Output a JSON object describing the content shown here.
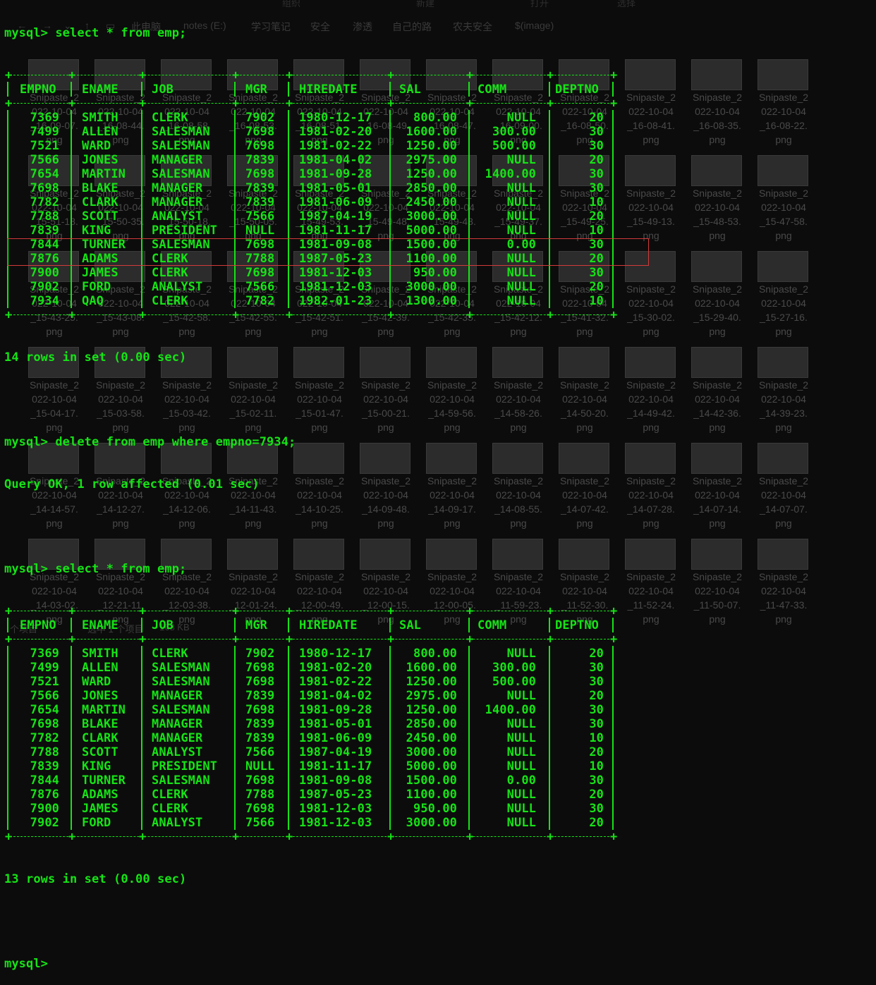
{
  "explorer": {
    "ribbon": [
      "组织",
      "新建",
      "打开",
      "选择"
    ],
    "path": [
      "此电脑",
      "notes (E:)",
      "学习笔记",
      "安全",
      "渗透",
      "自己的路",
      "农夫安全",
      "$(image)"
    ],
    "thumbnails": [
      {
        "col": 0,
        "row": 0,
        "l1": "Snipaste_2",
        "l2": "022-10-04",
        "l3": "_16-09-07.",
        "l4": "png"
      },
      {
        "col": 1,
        "row": 0,
        "l1": "Snipaste_2",
        "l2": "022-10-04",
        "l3": "_16-08-44.",
        "l4": "png"
      },
      {
        "col": 2,
        "row": 0,
        "l1": "Snipaste_2",
        "l2": "022-10-04",
        "l3": "_16-08-58.",
        "l4": "png"
      },
      {
        "col": 3,
        "row": 0,
        "l1": "Snipaste_2",
        "l2": "022-10-04",
        "l3": "_16-08-53.",
        "l4": "png"
      },
      {
        "col": 4,
        "row": 0,
        "l1": "Snipaste_2",
        "l2": "022-10-04",
        "l3": "_16-08-51.",
        "l4": "png"
      },
      {
        "col": 5,
        "row": 0,
        "l1": "Snipaste_2",
        "l2": "022-10-04",
        "l3": "_16-08-49.",
        "l4": "png"
      },
      {
        "col": 6,
        "row": 0,
        "l1": "Snipaste_2",
        "l2": "022-10-04",
        "l3": "_16-08-47.",
        "l4": "png"
      },
      {
        "col": 7,
        "row": 0,
        "l1": "Snipaste_2",
        "l2": "022-10-04",
        "l3": "_16-09-00.",
        "l4": "png"
      },
      {
        "col": 8,
        "row": 0,
        "l1": "Snipaste_2",
        "l2": "022-10-04",
        "l3": "_16-08-50.",
        "l4": "png"
      },
      {
        "col": 9,
        "row": 0,
        "l1": "Snipaste_2",
        "l2": "022-10-04",
        "l3": "_16-08-41.",
        "l4": "png"
      },
      {
        "col": 10,
        "row": 0,
        "l1": "Snipaste_2",
        "l2": "022-10-04",
        "l3": "_16-08-35.",
        "l4": "png"
      },
      {
        "col": 11,
        "row": 0,
        "l1": "Snipaste_2",
        "l2": "022-10-04",
        "l3": "_16-08-22.",
        "l4": "png"
      },
      {
        "col": 0,
        "row": 1,
        "l1": "Snipaste_2",
        "l2": "022-10-04",
        "l3": "_15-51-18.",
        "l4": "png"
      },
      {
        "col": 1,
        "row": 1,
        "l1": "Snipaste_2",
        "l2": "022-10-04",
        "l3": "_15-50-35.",
        "l4": "png"
      },
      {
        "col": 2,
        "row": 1,
        "l1": "Snipaste_2",
        "l2": "022-10-04",
        "l3": "_15-50-18.",
        "l4": "png"
      },
      {
        "col": 3,
        "row": 1,
        "l1": "Snipaste_2",
        "l2": "022-10-04",
        "l3": "_15-50-05.",
        "l4": "png"
      },
      {
        "col": 4,
        "row": 1,
        "l1": "Snipaste_2",
        "l2": "022-10-04",
        "l3": "_15-49-53.",
        "l4": "png"
      },
      {
        "col": 5,
        "row": 1,
        "l1": "Snipaste_2",
        "l2": "022-10-04",
        "l3": "_15-49-48.",
        "l4": "png"
      },
      {
        "col": 6,
        "row": 1,
        "l1": "Snipaste_2",
        "l2": "022-10-04",
        "l3": "_15-49-43.",
        "l4": "png"
      },
      {
        "col": 7,
        "row": 1,
        "l1": "Snipaste_2",
        "l2": "022-10-04",
        "l3": "_15-49-37.",
        "l4": "png"
      },
      {
        "col": 8,
        "row": 1,
        "l1": "Snipaste_2",
        "l2": "022-10-04",
        "l3": "_15-49-25.",
        "l4": "png"
      },
      {
        "col": 9,
        "row": 1,
        "l1": "Snipaste_2",
        "l2": "022-10-04",
        "l3": "_15-49-13.",
        "l4": "png"
      },
      {
        "col": 10,
        "row": 1,
        "l1": "Snipaste_2",
        "l2": "022-10-04",
        "l3": "_15-48-53.",
        "l4": "png"
      },
      {
        "col": 11,
        "row": 1,
        "l1": "Snipaste_2",
        "l2": "022-10-04",
        "l3": "_15-47-58.",
        "l4": "png"
      },
      {
        "col": 0,
        "row": 2,
        "l1": "Snipaste_2",
        "l2": "022-10-04",
        "l3": "_15-43-25.",
        "l4": "png"
      },
      {
        "col": 1,
        "row": 2,
        "l1": "Snipaste_2",
        "l2": "022-10-04",
        "l3": "_15-43-08.",
        "l4": "png"
      },
      {
        "col": 2,
        "row": 2,
        "l1": "Snipaste_2",
        "l2": "022-10-04",
        "l3": "_15-42-58.",
        "l4": "png"
      },
      {
        "col": 3,
        "row": 2,
        "l1": "Snipaste_2",
        "l2": "022-10-04",
        "l3": "_15-42-55.",
        "l4": "png"
      },
      {
        "col": 4,
        "row": 2,
        "l1": "Snipaste_2",
        "l2": "022-10-04",
        "l3": "_15-42-51.",
        "l4": "png"
      },
      {
        "col": 5,
        "row": 2,
        "l1": "Snipaste_2",
        "l2": "022-10-04",
        "l3": "_15-42-39.",
        "l4": "png"
      },
      {
        "col": 6,
        "row": 2,
        "l1": "Snipaste_2",
        "l2": "022-10-04",
        "l3": "_15-42-35.",
        "l4": "png"
      },
      {
        "col": 7,
        "row": 2,
        "l1": "Snipaste_2",
        "l2": "022-10-04",
        "l3": "_15-42-12.",
        "l4": "png"
      },
      {
        "col": 8,
        "row": 2,
        "l1": "Snipaste_2",
        "l2": "022-10-04",
        "l3": "_15-41-32.",
        "l4": "png"
      },
      {
        "col": 9,
        "row": 2,
        "l1": "Snipaste_2",
        "l2": "022-10-04",
        "l3": "_15-30-02.",
        "l4": "png"
      },
      {
        "col": 10,
        "row": 2,
        "l1": "Snipaste_2",
        "l2": "022-10-04",
        "l3": "_15-29-40.",
        "l4": "png"
      },
      {
        "col": 11,
        "row": 2,
        "l1": "Snipaste_2",
        "l2": "022-10-04",
        "l3": "_15-27-16.",
        "l4": "png"
      },
      {
        "col": 0,
        "row": 3,
        "l1": "Snipaste_2",
        "l2": "022-10-04",
        "l3": "_15-04-17.",
        "l4": "png"
      },
      {
        "col": 1,
        "row": 3,
        "l1": "Snipaste_2",
        "l2": "022-10-04",
        "l3": "_15-03-58.",
        "l4": "png"
      },
      {
        "col": 2,
        "row": 3,
        "l1": "Snipaste_2",
        "l2": "022-10-04",
        "l3": "_15-03-42.",
        "l4": "png"
      },
      {
        "col": 3,
        "row": 3,
        "l1": "Snipaste_2",
        "l2": "022-10-04",
        "l3": "_15-02-11.",
        "l4": "png"
      },
      {
        "col": 4,
        "row": 3,
        "l1": "Snipaste_2",
        "l2": "022-10-04",
        "l3": "_15-01-47.",
        "l4": "png"
      },
      {
        "col": 5,
        "row": 3,
        "l1": "Snipaste_2",
        "l2": "022-10-04",
        "l3": "_15-00-21.",
        "l4": "png"
      },
      {
        "col": 6,
        "row": 3,
        "l1": "Snipaste_2",
        "l2": "022-10-04",
        "l3": "_14-59-56.",
        "l4": "png"
      },
      {
        "col": 7,
        "row": 3,
        "l1": "Snipaste_2",
        "l2": "022-10-04",
        "l3": "_14-58-26.",
        "l4": "png"
      },
      {
        "col": 8,
        "row": 3,
        "l1": "Snipaste_2",
        "l2": "022-10-04",
        "l3": "_14-50-20.",
        "l4": "png"
      },
      {
        "col": 9,
        "row": 3,
        "l1": "Snipaste_2",
        "l2": "022-10-04",
        "l3": "_14-49-42.",
        "l4": "png"
      },
      {
        "col": 10,
        "row": 3,
        "l1": "Snipaste_2",
        "l2": "022-10-04",
        "l3": "_14-42-36.",
        "l4": "png"
      },
      {
        "col": 11,
        "row": 3,
        "l1": "Snipaste_2",
        "l2": "022-10-04",
        "l3": "_14-39-23.",
        "l4": "png"
      },
      {
        "col": 0,
        "row": 4,
        "l1": "Snipaste_2",
        "l2": "022-10-04",
        "l3": "_14-14-57.",
        "l4": "png"
      },
      {
        "col": 1,
        "row": 4,
        "l1": "Snipaste_2",
        "l2": "022-10-04",
        "l3": "_14-12-27.",
        "l4": "png"
      },
      {
        "col": 2,
        "row": 4,
        "l1": "Snipaste_2",
        "l2": "022-10-04",
        "l3": "_14-12-06.",
        "l4": "png"
      },
      {
        "col": 3,
        "row": 4,
        "l1": "Snipaste_2",
        "l2": "022-10-04",
        "l3": "_14-11-43.",
        "l4": "png"
      },
      {
        "col": 4,
        "row": 4,
        "l1": "Snipaste_2",
        "l2": "022-10-04",
        "l3": "_14-10-25.",
        "l4": "png"
      },
      {
        "col": 5,
        "row": 4,
        "l1": "Snipaste_2",
        "l2": "022-10-04",
        "l3": "_14-09-48.",
        "l4": "png"
      },
      {
        "col": 6,
        "row": 4,
        "l1": "Snipaste_2",
        "l2": "022-10-04",
        "l3": "_14-09-17.",
        "l4": "png"
      },
      {
        "col": 7,
        "row": 4,
        "l1": "Snipaste_2",
        "l2": "022-10-04",
        "l3": "_14-08-55.",
        "l4": "png"
      },
      {
        "col": 8,
        "row": 4,
        "l1": "Snipaste_2",
        "l2": "022-10-04",
        "l3": "_14-07-42.",
        "l4": "png"
      },
      {
        "col": 9,
        "row": 4,
        "l1": "Snipaste_2",
        "l2": "022-10-04",
        "l3": "_14-07-28.",
        "l4": "png"
      },
      {
        "col": 10,
        "row": 4,
        "l1": "Snipaste_2",
        "l2": "022-10-04",
        "l3": "_14-07-14.",
        "l4": "png"
      },
      {
        "col": 11,
        "row": 4,
        "l1": "Snipaste_2",
        "l2": "022-10-04",
        "l3": "_14-07-07.",
        "l4": "png"
      },
      {
        "col": 0,
        "row": 5,
        "l1": "Snipaste_2",
        "l2": "022-10-04",
        "l3": "_14-03-02.",
        "l4": "png"
      },
      {
        "col": 1,
        "row": 5,
        "l1": "Snipaste_2",
        "l2": "022-10-04",
        "l3": "_12-21-11.",
        "l4": "png"
      },
      {
        "col": 2,
        "row": 5,
        "l1": "Snipaste_2",
        "l2": "022-10-04",
        "l3": "_12-03-38.",
        "l4": "png"
      },
      {
        "col": 3,
        "row": 5,
        "l1": "Snipaste_2",
        "l2": "022-10-04",
        "l3": "_12-01-24.",
        "l4": "png"
      },
      {
        "col": 4,
        "row": 5,
        "l1": "Snipaste_2",
        "l2": "022-10-04",
        "l3": "_12-00-49.",
        "l4": "png"
      },
      {
        "col": 5,
        "row": 5,
        "l1": "Snipaste_2",
        "l2": "022-10-04",
        "l3": "_12-00-15.",
        "l4": "png"
      },
      {
        "col": 6,
        "row": 5,
        "l1": "Snipaste_2",
        "l2": "022-10-04",
        "l3": "_12-00-05.",
        "l4": "png"
      },
      {
        "col": 7,
        "row": 5,
        "l1": "Snipaste_2",
        "l2": "022-10-04",
        "l3": "_11-59-23.",
        "l4": "png"
      },
      {
        "col": 8,
        "row": 5,
        "l1": "Snipaste_2",
        "l2": "022-10-04",
        "l3": "_11-52-30.",
        "l4": "png"
      },
      {
        "col": 9,
        "row": 5,
        "l1": "Snipaste_2",
        "l2": "022-10-04",
        "l3": "_11-52-24.",
        "l4": "png"
      },
      {
        "col": 10,
        "row": 5,
        "l1": "Snipaste_2",
        "l2": "022-10-04",
        "l3": "_11-50-07.",
        "l4": "png"
      },
      {
        "col": 11,
        "row": 5,
        "l1": "Snipaste_2",
        "l2": "022-10-04",
        "l3": "_11-47-33.",
        "l4": "png"
      }
    ],
    "status": {
      "count": "个项目",
      "selected": "选中 1 个项目",
      "size": "168 KB"
    }
  },
  "terminal": {
    "cmd1": "mysql> select * from emp;",
    "columns": [
      "EMPNO",
      "ENAME",
      "JOB",
      "MGR",
      "HIREDATE",
      "SAL",
      "COMM",
      "DEPTNO"
    ],
    "table1": [
      [
        "7369",
        "SMITH",
        "CLERK",
        "7902",
        "1980-12-17",
        "800.00",
        "NULL",
        "20"
      ],
      [
        "7499",
        "ALLEN",
        "SALESMAN",
        "7698",
        "1981-02-20",
        "1600.00",
        "300.00",
        "30"
      ],
      [
        "7521",
        "WARD",
        "SALESMAN",
        "7698",
        "1981-02-22",
        "1250.00",
        "500.00",
        "30"
      ],
      [
        "7566",
        "JONES",
        "MANAGER",
        "7839",
        "1981-04-02",
        "2975.00",
        "NULL",
        "20"
      ],
      [
        "7654",
        "MARTIN",
        "SALESMAN",
        "7698",
        "1981-09-28",
        "1250.00",
        "1400.00",
        "30"
      ],
      [
        "7698",
        "BLAKE",
        "MANAGER",
        "7839",
        "1981-05-01",
        "2850.00",
        "NULL",
        "30"
      ],
      [
        "7782",
        "CLARK",
        "MANAGER",
        "7839",
        "1981-06-09",
        "2450.00",
        "NULL",
        "10"
      ],
      [
        "7788",
        "SCOTT",
        "ANALYST",
        "7566",
        "1987-04-19",
        "3000.00",
        "NULL",
        "20"
      ],
      [
        "7839",
        "KING",
        "PRESIDENT",
        "NULL",
        "1981-11-17",
        "5000.00",
        "NULL",
        "10"
      ],
      [
        "7844",
        "TURNER",
        "SALESMAN",
        "7698",
        "1981-09-08",
        "1500.00",
        "0.00",
        "30"
      ],
      [
        "7876",
        "ADAMS",
        "CLERK",
        "7788",
        "1987-05-23",
        "1100.00",
        "NULL",
        "20"
      ],
      [
        "7900",
        "JAMES",
        "CLERK",
        "7698",
        "1981-12-03",
        "950.00",
        "NULL",
        "30"
      ],
      [
        "7902",
        "FORD",
        "ANALYST",
        "7566",
        "1981-12-03",
        "3000.00",
        "NULL",
        "20"
      ],
      [
        "7934",
        "QAQ",
        "CLERK",
        "7782",
        "1982-01-23",
        "1300.00",
        "NULL",
        "10"
      ]
    ],
    "result1": "14 rows in set (0.00 sec)",
    "cmd2": "mysql> delete from emp where empno=7934;",
    "result2": "Query OK, 1 row affected (0.01 sec)",
    "cmd3": "mysql> select * from emp;",
    "table2": [
      [
        "7369",
        "SMITH",
        "CLERK",
        "7902",
        "1980-12-17",
        "800.00",
        "NULL",
        "20"
      ],
      [
        "7499",
        "ALLEN",
        "SALESMAN",
        "7698",
        "1981-02-20",
        "1600.00",
        "300.00",
        "30"
      ],
      [
        "7521",
        "WARD",
        "SALESMAN",
        "7698",
        "1981-02-22",
        "1250.00",
        "500.00",
        "30"
      ],
      [
        "7566",
        "JONES",
        "MANAGER",
        "7839",
        "1981-04-02",
        "2975.00",
        "NULL",
        "20"
      ],
      [
        "7654",
        "MARTIN",
        "SALESMAN",
        "7698",
        "1981-09-28",
        "1250.00",
        "1400.00",
        "30"
      ],
      [
        "7698",
        "BLAKE",
        "MANAGER",
        "7839",
        "1981-05-01",
        "2850.00",
        "NULL",
        "30"
      ],
      [
        "7782",
        "CLARK",
        "MANAGER",
        "7839",
        "1981-06-09",
        "2450.00",
        "NULL",
        "10"
      ],
      [
        "7788",
        "SCOTT",
        "ANALYST",
        "7566",
        "1987-04-19",
        "3000.00",
        "NULL",
        "20"
      ],
      [
        "7839",
        "KING",
        "PRESIDENT",
        "NULL",
        "1981-11-17",
        "5000.00",
        "NULL",
        "10"
      ],
      [
        "7844",
        "TURNER",
        "SALESMAN",
        "7698",
        "1981-09-08",
        "1500.00",
        "0.00",
        "30"
      ],
      [
        "7876",
        "ADAMS",
        "CLERK",
        "7788",
        "1987-05-23",
        "1100.00",
        "NULL",
        "20"
      ],
      [
        "7900",
        "JAMES",
        "CLERK",
        "7698",
        "1981-12-03",
        "950.00",
        "NULL",
        "30"
      ],
      [
        "7902",
        "FORD",
        "ANALYST",
        "7566",
        "1981-12-03",
        "3000.00",
        "NULL",
        "20"
      ]
    ],
    "result3": "13 rows in set (0.00 sec)",
    "prompt": "mysql>",
    "text_color": "#16e316",
    "highlight_color": "#d23a3a"
  }
}
